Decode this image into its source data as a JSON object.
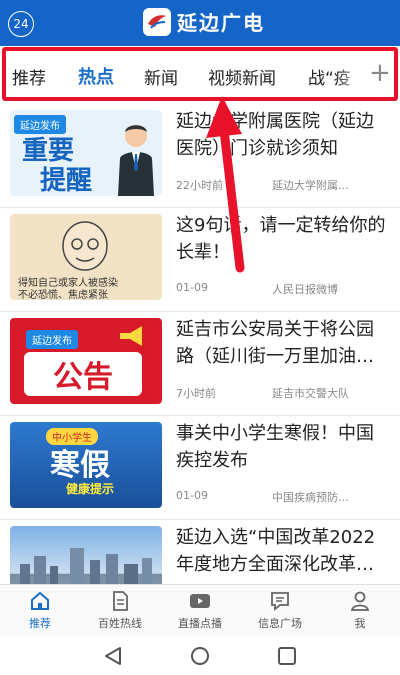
{
  "header": {
    "badge": "24",
    "title": "延边广电",
    "logo_icon": "yanbian-broadcast-logo"
  },
  "tabs": [
    {
      "label": "推荐",
      "active": false
    },
    {
      "label": "热点",
      "active": true
    },
    {
      "label": "新闻",
      "active": false
    },
    {
      "label": "视频新闻",
      "active": false
    },
    {
      "label": "战“疫",
      "active": false
    }
  ],
  "tab_add_label": "+",
  "feed": [
    {
      "title": "延边大学附属医院（延边医院）门诊就诊须知",
      "time": "22小时前",
      "source": "延边大学附属...",
      "thumb": {
        "tag": "延边发布",
        "line1": "重要",
        "line2": "提醒"
      }
    },
    {
      "title": "这9句话，请一定转给你的长辈！",
      "time": "01-09",
      "source": "人民日报微博",
      "thumb": {
        "caption1": "得知自己或家人被感染",
        "caption2": "不必恐慌、焦虑紧张"
      }
    },
    {
      "title": "延吉市公安局关于将公园路（延川街一万里加油…",
      "time": "7小时前",
      "source": "延吉市交警大队",
      "thumb": {
        "tag": "延边发布",
        "text": "公告"
      }
    },
    {
      "title": "事关中小学生寒假！中国疾控发布",
      "time": "01-09",
      "source": "中国疾病预防...",
      "thumb": {
        "top": "中小学生",
        "big": "寒假",
        "sub": "健康提示"
      }
    },
    {
      "title": "延边入选“中国改革2022年度地方全面深化改革…",
      "time": "",
      "source": "",
      "thumb": {}
    }
  ],
  "bottom_nav": [
    {
      "label": "推荐",
      "icon": "home-icon",
      "active": true
    },
    {
      "label": "百姓热线",
      "icon": "document-icon",
      "active": false
    },
    {
      "label": "直播点播",
      "icon": "play-icon",
      "active": false
    },
    {
      "label": "信息广场",
      "icon": "message-icon",
      "active": false
    },
    {
      "label": "我",
      "icon": "user-icon",
      "active": false
    }
  ],
  "colors": {
    "brand": "#1565c8",
    "accent": "#1a6fc8",
    "highlight": "#e8122a"
  }
}
